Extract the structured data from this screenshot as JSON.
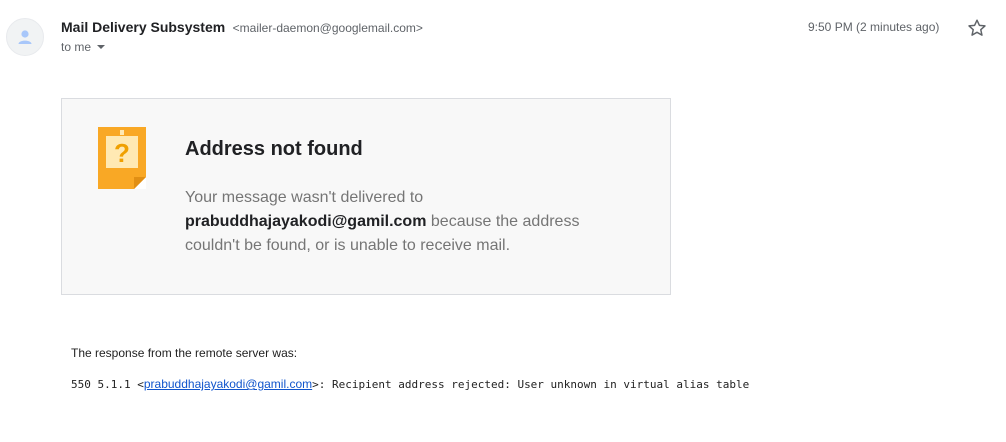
{
  "header": {
    "sender_name": "Mail Delivery Subsystem",
    "sender_email": "<mailer-daemon@googlemail.com>",
    "recipient_label": "to me",
    "timestamp": "9:50 PM (2 minutes ago)"
  },
  "card": {
    "title": "Address not found",
    "body_prefix": "Your message wasn't delivered to",
    "address": "prabuddhajayakodi@gamil.com",
    "body_suffix": "because the address couldn't be found, or is unable to receive mail."
  },
  "response": {
    "label": "The response from the remote server was:",
    "code": "550 5.1.1 <",
    "email_link": "prabuddhajayakodi@gamil.com",
    "message": ">: Recipient address rejected: User unknown in virtual alias table"
  },
  "icons": {
    "avatar": "person-icon",
    "star": "star-icon",
    "alert": "question-note-icon"
  },
  "colors": {
    "alert_orange": "#f9a825",
    "link": "#1155cc"
  }
}
